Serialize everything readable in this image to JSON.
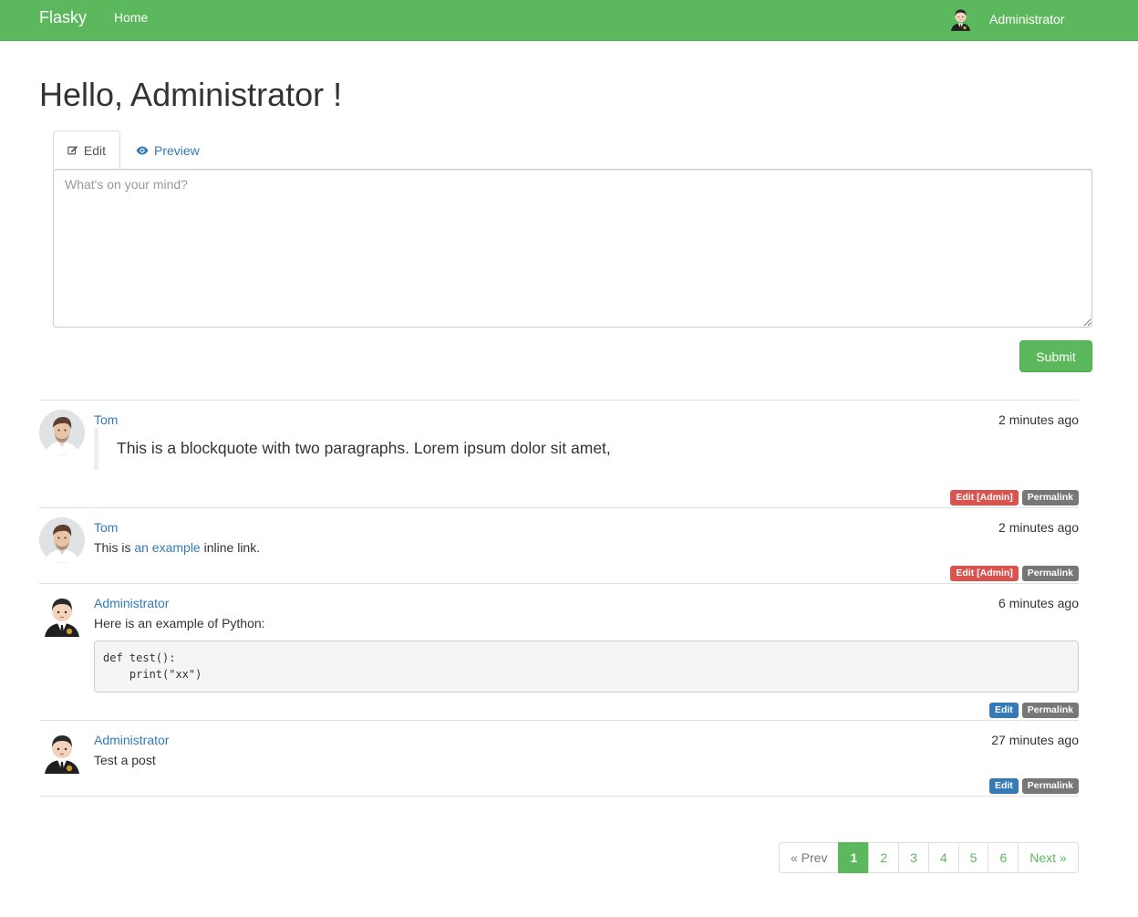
{
  "navbar": {
    "brand": "Flasky",
    "home": "Home",
    "user": "Administrator"
  },
  "title": "Hello, Administrator !",
  "tabs": [
    {
      "label": "Edit",
      "icon": "pencil-square-icon",
      "active": true
    },
    {
      "label": "Preview",
      "icon": "eye-icon",
      "active": false
    }
  ],
  "editor": {
    "placeholder": "What's on your mind?",
    "value": ""
  },
  "submit_label": "Submit",
  "posts": [
    {
      "author": "Tom",
      "avatar": "man-avatar-icon",
      "date": "2 minutes ago",
      "blockquote": "This is a blockquote with two paragraphs. Lorem ipsum dolor sit amet,",
      "actions": [
        "Edit [Admin]",
        "Permalink"
      ]
    },
    {
      "author": "Tom",
      "avatar": "man-avatar-icon",
      "date": "2 minutes ago",
      "text_before": "This is",
      "link": "an example",
      "text_after": "inline link.",
      "actions": [
        "Edit [Admin]",
        "Permalink"
      ]
    },
    {
      "author": "Administrator",
      "avatar": "admin-avatar-icon",
      "date": "6 minutes ago",
      "text": "Here is an example of Python:",
      "code": "def test():\n    print(\"xx\")",
      "actions": [
        "Edit",
        "Permalink"
      ]
    },
    {
      "author": "Administrator",
      "avatar": "admin-avatar-icon",
      "date": "27 minutes ago",
      "text": "Test a post",
      "actions": [
        "Edit",
        "Permalink"
      ]
    }
  ],
  "pagination": {
    "prev": "« Prev",
    "pages": [
      "1",
      "2",
      "3",
      "4",
      "5",
      "6"
    ],
    "current": "1",
    "next": "Next »"
  },
  "colors": {
    "navbar": "#5cb85c",
    "link": "#337ab7",
    "danger": "#d9534f",
    "primary": "#337ab7",
    "default_label": "#777777"
  }
}
